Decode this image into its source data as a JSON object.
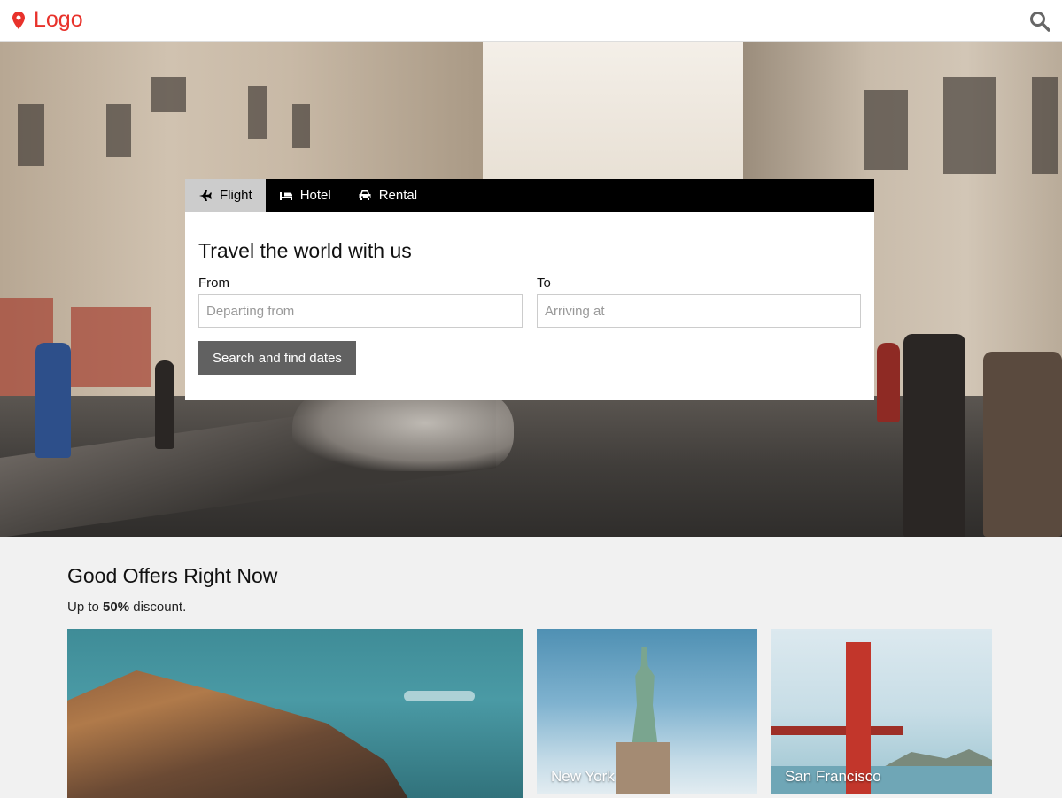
{
  "header": {
    "logo_text": "Logo",
    "logo_icon": "map-marker-icon",
    "search_icon": "search-icon",
    "accent_color": "#e8322b"
  },
  "search_card": {
    "tabs": [
      {
        "label": "Flight",
        "icon": "plane-icon",
        "active": true
      },
      {
        "label": "Hotel",
        "icon": "bed-icon",
        "active": false
      },
      {
        "label": "Rental",
        "icon": "car-icon",
        "active": false
      }
    ],
    "title": "Travel the world with us",
    "from": {
      "label": "From",
      "placeholder": "Departing from",
      "value": ""
    },
    "to": {
      "label": "To",
      "placeholder": "Arriving at",
      "value": ""
    },
    "submit_label": "Search and find dates"
  },
  "offers": {
    "heading": "Good Offers Right Now",
    "subtitle_prefix": "Up to ",
    "subtitle_emphasis": "50%",
    "subtitle_suffix": " discount.",
    "tiles": [
      {
        "label": ""
      },
      {
        "label": "New York"
      },
      {
        "label": "San Francisco"
      }
    ]
  }
}
